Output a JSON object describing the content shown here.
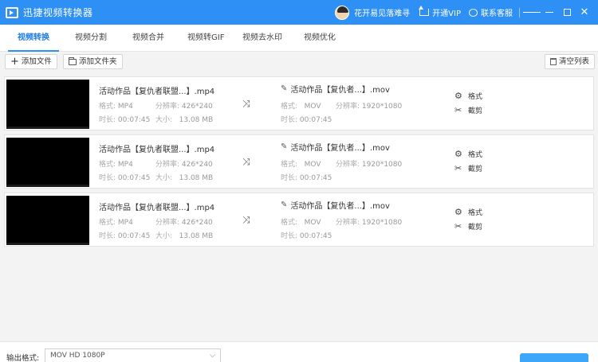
{
  "app": {
    "title": "迅捷视频转换器",
    "user_name": "花开易见落难寻",
    "vip_label": "开通VIP",
    "service_label": "联系客服"
  },
  "tabs": [
    {
      "label": "视频转换",
      "active": true
    },
    {
      "label": "视频分割"
    },
    {
      "label": "视频合并"
    },
    {
      "label": "视频转GIF"
    },
    {
      "label": "视频去水印"
    },
    {
      "label": "视频优化"
    }
  ],
  "toolbar": {
    "add_file": "添加文件",
    "add_folder": "添加文件夹",
    "clear_list": "清空列表"
  },
  "labels": {
    "format": "格式:",
    "resolution": "分辨率:",
    "duration": "时长:",
    "size": "大小:",
    "format_btn": "格式",
    "cut_btn": "截剪"
  },
  "files": [
    {
      "src_name": "活动作品【复仇者联盟...】.mp4",
      "src_format": "MP4",
      "src_resolution": "426*240",
      "src_duration": "00:07:45",
      "src_size": "13.08 MB",
      "out_name": "活动作品【复仇者...】.mov",
      "out_format": "MOV",
      "out_resolution": "1920*1080",
      "out_duration": "00:07:45"
    },
    {
      "src_name": "活动作品【复仇者联盟...】.mp4",
      "src_format": "MP4",
      "src_resolution": "426*240",
      "src_duration": "00:07:45",
      "src_size": "13.08 MB",
      "out_name": "活动作品【复仇者...】.mov",
      "out_format": "MOV",
      "out_resolution": "1920*1080",
      "out_duration": "00:07:45"
    },
    {
      "src_name": "活动作品【复仇者联盟...】.mp4",
      "src_format": "MP4",
      "src_resolution": "426*240",
      "src_duration": "00:07:45",
      "src_size": "13.08 MB",
      "out_name": "活动作品【复仇者...】.mov",
      "out_format": "MOV",
      "out_resolution": "1920*1080",
      "out_duration": "00:07:45"
    }
  ],
  "bottom": {
    "output_label": "输出格式:",
    "output_format": "MOV   HD 1080P"
  },
  "colors": {
    "accent": "#2e8ff5",
    "tab_active": "#1d7be8",
    "convert": "#3ea6f7"
  }
}
